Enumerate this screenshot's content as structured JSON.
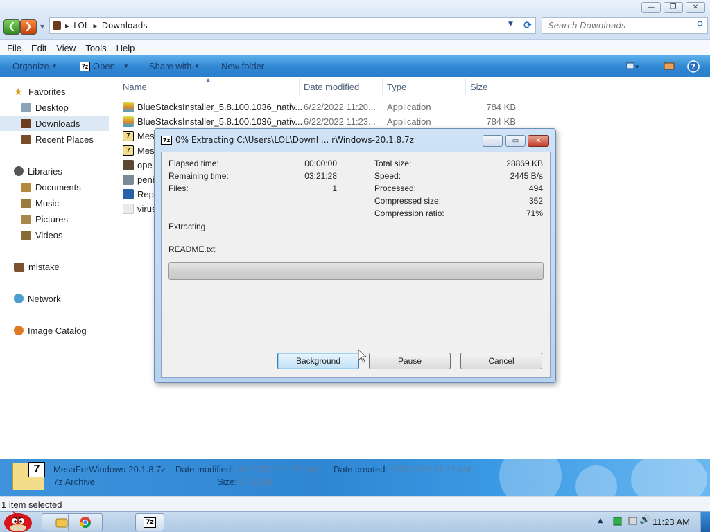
{
  "explorer": {
    "window_controls": {
      "minimize": "—",
      "maximize": "❐",
      "close": "✕"
    },
    "breadcrumb": [
      "LOL",
      "Downloads"
    ],
    "search_placeholder": "Search Downloads",
    "menu": [
      "File",
      "Edit",
      "View",
      "Tools",
      "Help"
    ],
    "toolbar": {
      "organize": "Organize",
      "open": "Open",
      "share_with": "Share with",
      "new_folder": "New folder"
    },
    "nav": {
      "favorites": "Favorites",
      "favorites_items": [
        "Desktop",
        "Downloads",
        "Recent Places"
      ],
      "libraries": "Libraries",
      "libraries_items": [
        "Documents",
        "Music",
        "Pictures",
        "Videos"
      ],
      "user": "mistake",
      "network": "Network",
      "image_catalog": "Image Catalog",
      "selected": "Downloads"
    },
    "columns": [
      "Name",
      "Date modified",
      "Type",
      "Size"
    ],
    "files": [
      {
        "name": "BlueStacksInstaller_5.8.100.1036_nativ...",
        "date": "6/22/2022 11:20...",
        "type": "Application",
        "size": "784 KB"
      },
      {
        "name": "BlueStacksInstaller_5.8.100.1036_nativ...",
        "date": "6/22/2022 11:23...",
        "type": "Application",
        "size": "784 KB"
      },
      {
        "name": "Mes",
        "date": "",
        "type": "",
        "size": ""
      },
      {
        "name": "Mes",
        "date": "",
        "type": "",
        "size": ""
      },
      {
        "name": "ope",
        "date": "",
        "type": "",
        "size": ""
      },
      {
        "name": "peni",
        "date": "",
        "type": "",
        "size": ""
      },
      {
        "name": "Rep",
        "date": "",
        "type": "",
        "size": ""
      },
      {
        "name": "virus",
        "date": "",
        "type": "",
        "size": ""
      }
    ],
    "details": {
      "filename": "MesaForWindows-20.1.8.7z",
      "filetype": "7z Archive",
      "date_modified_label": "Date modified:",
      "date_modified": "6/22/2022 11:22 AM",
      "date_created_label": "Date created:",
      "date_created": "6/22/2022 11:22 AM",
      "size_label": "Size:",
      "size": "6.73 MB",
      "icon_badge": "7"
    },
    "status": "1 item selected"
  },
  "dialog": {
    "title": "0% Extracting C:\\Users\\LOL\\Downl ... rWindows-20.1.8.7z",
    "icon_label": "7z",
    "left_stats": [
      {
        "label": "Elapsed time:",
        "value": "00:00:00"
      },
      {
        "label": "Remaining time:",
        "value": "03:21:28"
      },
      {
        "label": "Files:",
        "value": "1"
      }
    ],
    "right_stats": [
      {
        "label": "Total size:",
        "value": "28869 KB"
      },
      {
        "label": "Speed:",
        "value": "2445 B/s"
      },
      {
        "label": "Processed:",
        "value": "494"
      },
      {
        "label": "Compressed size:",
        "value": "352"
      },
      {
        "label": "Compression ratio:",
        "value": "71%"
      }
    ],
    "action": "Extracting",
    "current_file": "README.txt",
    "progress": 0,
    "buttons": {
      "background": "Background",
      "pause": "Pause",
      "cancel": "Cancel"
    },
    "controls": {
      "minimize": "—",
      "maximize": "▭",
      "close": "✕"
    }
  },
  "taskbar": {
    "chrome_icon": "chrome-icon",
    "sevenzip_label": "7z",
    "clock": "11:23 AM"
  },
  "colors": {
    "command_bar": "#2f86d2",
    "details_pane": "#2f86d2",
    "progress_fill": "#2ea52b"
  }
}
